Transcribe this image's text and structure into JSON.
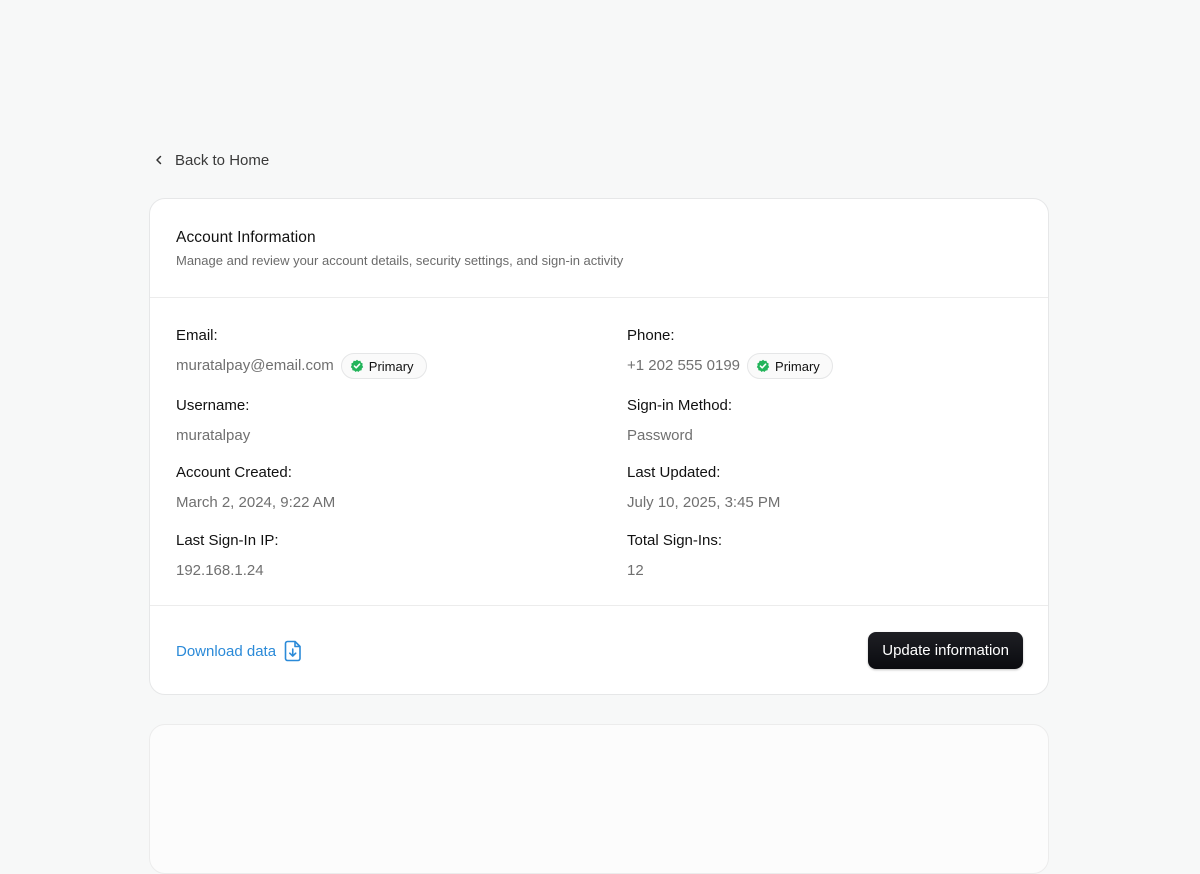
{
  "nav": {
    "back_label": "Back to Home"
  },
  "account": {
    "title": "Account Information",
    "subtitle": "Manage and review your account details, security settings, and sign-in activity",
    "fields": {
      "email": {
        "label": "Email:",
        "value": "muratalpay@email.com",
        "badge": "Primary"
      },
      "phone": {
        "label": "Phone:",
        "value": "+1 202 555 0199",
        "badge": "Primary"
      },
      "username": {
        "label": "Username:",
        "value": "muratalpay"
      },
      "signin_method": {
        "label": "Sign-in Method:",
        "value": "Password"
      },
      "created": {
        "label": "Account Created:",
        "value": "March 2, 2024, 9:22 AM"
      },
      "updated": {
        "label": "Last Updated:",
        "value": "July 10, 2025, 3:45 PM"
      },
      "last_ip": {
        "label": "Last Sign-In IP:",
        "value": "192.168.1.24"
      },
      "total_signins": {
        "label": "Total Sign-Ins:",
        "value": "12"
      }
    },
    "footer": {
      "download_label": "Download data",
      "update_label": "Update information"
    }
  },
  "icons": {
    "back": "chevron-left-icon",
    "verified": "verified-badge-icon",
    "download": "file-download-icon"
  },
  "colors": {
    "background": "#f7f8f8",
    "card": "#ffffff",
    "link": "#2b8ad8",
    "verified": "#22b45a",
    "button": "#111217"
  }
}
